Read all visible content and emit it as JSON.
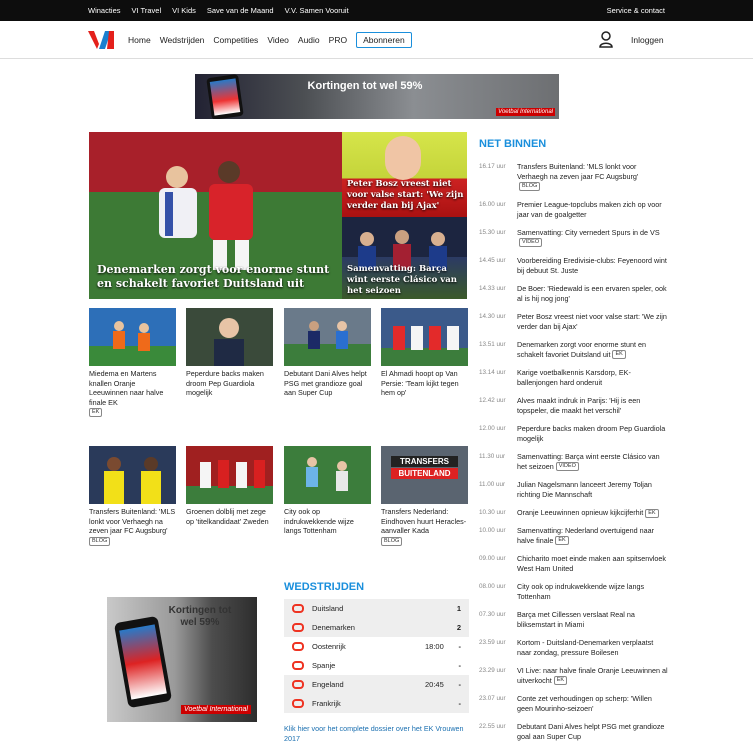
{
  "topbar": {
    "links": [
      "Winacties",
      "VI Travel",
      "VI Kids",
      "Save van de Maand",
      "V.V. Samen Vooruit"
    ],
    "service": "Service & contact"
  },
  "nav": {
    "items": [
      "Home",
      "Wedstrijden",
      "Competities",
      "Video",
      "Audio",
      "PRO"
    ],
    "subscribe": "Abonneren",
    "login": "Inloggen"
  },
  "banner": {
    "text": "Kortingen tot wel 59%",
    "brand": "Voetbal International"
  },
  "hero": {
    "main": "Denemarken zorgt voor enorme stunt en schakelt favoriet Duitsland uit",
    "top": "Peter Bosz vreest niet voor valse start: 'We zijn verder dan bij Ajax'",
    "bottom": "Samenvatting: Barça wint eerste Clásico van het seizoen"
  },
  "articles_row1": [
    {
      "title": "Miedema en Martens knallen Oranje Leeuwinnen naar halve finale EK",
      "tag": "EK"
    },
    {
      "title": "Peperdure backs maken droom Pep Guardiola mogelijk",
      "tag": ""
    },
    {
      "title": "Debutant Dani Alves helpt PSG met grandioze goal aan Super Cup",
      "tag": ""
    },
    {
      "title": "El Ahmadi hoopt op Van Persie: 'Team kijkt tegen hem op'",
      "tag": ""
    }
  ],
  "articles_row2": [
    {
      "title": "Transfers Buitenland: 'MLS lonkt voor Verhaegh na zeven jaar FC Augsburg'",
      "tag": "BLOG"
    },
    {
      "title": "Groenen dolblij met zege op 'titelkandidaat' Zweden",
      "tag": ""
    },
    {
      "title": "City ook op indrukwekkende wijze langs Tottenham",
      "tag": ""
    },
    {
      "title": "Transfers Nederland: Eindhoven huurt Heracles-aanvaller Kada",
      "tag": "BLOG"
    }
  ],
  "transfers_thumb": {
    "line1": "TRANSFERS",
    "line2": "BUITENLAND"
  },
  "ad2": {
    "text": "Kortingen tot wel 59%",
    "brand": "Voetbal International"
  },
  "wedstrijden": {
    "heading": "WEDSTRIJDEN",
    "matches": [
      {
        "home": "Duitsland",
        "away": "Denemarken",
        "home_score": "1",
        "away_score": "2",
        "time": ""
      },
      {
        "home": "Oostenrijk",
        "away": "Spanje",
        "home_score": "-",
        "away_score": "-",
        "time": "18:00"
      },
      {
        "home": "Engeland",
        "away": "Frankrijk",
        "home_score": "-",
        "away_score": "-",
        "time": "20:45"
      }
    ],
    "link": "Klik hier voor het complete dossier over het EK Vrouwen 2017"
  },
  "net_binnen": {
    "heading": "NET BINNEN",
    "items": [
      {
        "time": "16.17 uur",
        "title": "Transfers Buitenland: 'MLS lonkt voor Verhaegh na zeven jaar FC Augsburg'",
        "tag": "BLOG"
      },
      {
        "time": "16.00 uur",
        "title": "Premier League-topclubs maken zich op voor jaar van de goalgetter",
        "tag": ""
      },
      {
        "time": "15.30 uur",
        "title": "Samenvatting: City vernedert Spurs in de VS",
        "tag": "VIDEO"
      },
      {
        "time": "14.45 uur",
        "title": "Voorbereiding Eredivisie-clubs: Feyenoord wint bij debuut St. Juste",
        "tag": ""
      },
      {
        "time": "14.33 uur",
        "title": "De Boer: 'Riedewald is een ervaren speler, ook al is hij nog jong'",
        "tag": ""
      },
      {
        "time": "14.30 uur",
        "title": "Peter Bosz vreest niet voor valse start: 'We zijn verder dan bij Ajax'",
        "tag": ""
      },
      {
        "time": "13.51 uur",
        "title": "Denemarken zorgt voor enorme stunt en schakelt favoriet Duitsland uit",
        "tag": "EK"
      },
      {
        "time": "13.14 uur",
        "title": "Karige voetbalkennis Karsdorp, EK-ballenjongen hard onderuit",
        "tag": ""
      },
      {
        "time": "12.42 uur",
        "title": "Alves maakt indruk in Parijs: 'Hij is een topspeler, die maakt het verschil'",
        "tag": ""
      },
      {
        "time": "12.00 uur",
        "title": "Peperdure backs maken droom Pep Guardiola mogelijk",
        "tag": ""
      },
      {
        "time": "11.30 uur",
        "title": "Samenvatting: Barça wint eerste Clásico van het seizoen",
        "tag": "VIDEO"
      },
      {
        "time": "11.00 uur",
        "title": "Julian Nagelsmann lanceert Jeremy Toljan richting Die Mannschaft",
        "tag": ""
      },
      {
        "time": "10.30 uur",
        "title": "Oranje Leeuwinnen opnieuw kijkcijferhit",
        "tag": "EK"
      },
      {
        "time": "10.00 uur",
        "title": "Samenvatting: Nederland overtuigend naar halve finale",
        "tag": "EK"
      },
      {
        "time": "09.00 uur",
        "title": "Chicharito moet einde maken aan spitsenvloek West Ham United",
        "tag": ""
      },
      {
        "time": "08.00 uur",
        "title": "City ook op indrukwekkende wijze langs Tottenham",
        "tag": ""
      },
      {
        "time": "07.30 uur",
        "title": "Barça met Cillessen verslaat Real na bliksemstart in Miami",
        "tag": ""
      },
      {
        "time": "23.59 uur",
        "title": "Kortom - Duitsland-Denemarken verplaatst naar zondag, pressure Boilesen",
        "tag": ""
      },
      {
        "time": "23.29 uur",
        "title": "VI Live: naar halve finale Oranje Leeuwinnen al uitverkocht",
        "tag": "EK"
      },
      {
        "time": "23.07 uur",
        "title": "Conte zet verhoudingen op scherp: 'Willen geen Mourinho-seizoen'",
        "tag": ""
      },
      {
        "time": "22.55 uur",
        "title": "Debutant Dani Alves helpt PSG met grandioze goal aan Super Cup",
        "tag": ""
      }
    ]
  }
}
